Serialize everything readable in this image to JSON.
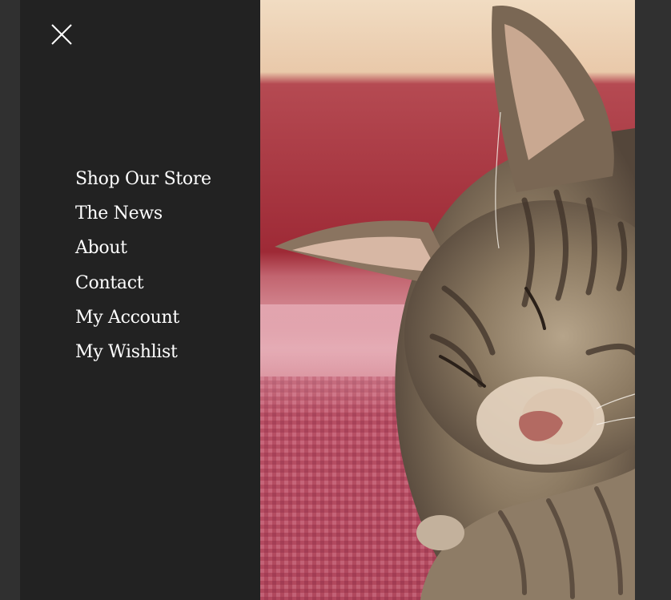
{
  "menu": {
    "close_icon": "close-icon",
    "items": [
      {
        "label": "Shop Our Store"
      },
      {
        "label": "The News"
      },
      {
        "label": "About"
      },
      {
        "label": "Contact"
      },
      {
        "label": "My Account"
      },
      {
        "label": "My Wishlist"
      }
    ]
  },
  "hero_image": {
    "subject": "sleeping-tabby-cat-photo"
  },
  "colors": {
    "page_background": "#303030",
    "menu_background": "#222222",
    "menu_text": "#ffffff"
  }
}
